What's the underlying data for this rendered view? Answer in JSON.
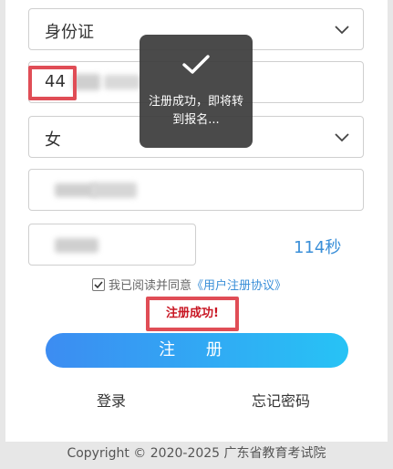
{
  "form": {
    "id_type_value": "身份证",
    "id_number_prefix": "44",
    "gender_value": "女",
    "countdown_text": "114秒"
  },
  "agreement": {
    "prefix": "我已阅读并同意",
    "link": "《用户注册协议》",
    "checked": true
  },
  "success_message": "注册成功!",
  "register_button_label": "注 册",
  "links": {
    "login": "登录",
    "forgot_password": "忘记密码"
  },
  "footer": {
    "copyright": "Copyright © 2020-2025 广东省教育考试院"
  },
  "toast": {
    "message": "注册成功，即将转到报名..."
  },
  "colors": {
    "accent": "#3a8fd8",
    "highlight_red": "#e04d56",
    "success_text": "#c81623"
  }
}
